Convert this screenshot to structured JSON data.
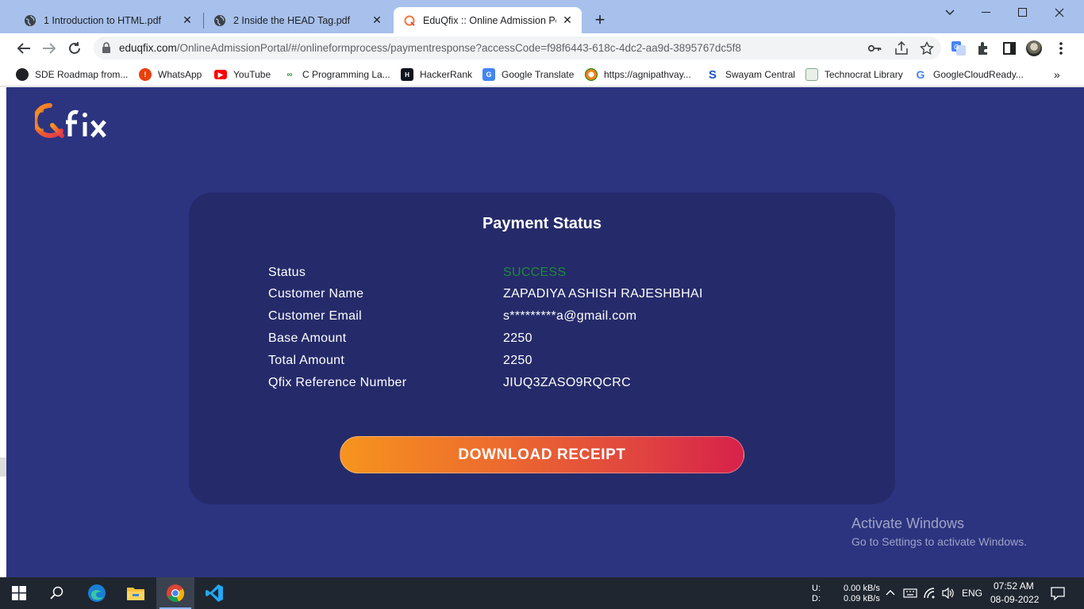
{
  "browser": {
    "tabs": [
      {
        "title": "1 Introduction to HTML.pdf",
        "active": false
      },
      {
        "title": "2 Inside the HEAD Tag.pdf",
        "active": false
      },
      {
        "title": "EduQfix :: Online Admission Portal",
        "active": true
      }
    ],
    "url_host": "eduqfix.com",
    "url_path": "/OnlineAdmissionPortal/#/onlineformprocess/paymentresponse?accessCode=f98f6443-618c-4dc2-aa9d-3895767dc5f8",
    "bookmarks": [
      {
        "label": "SDE Roadmap from...",
        "icon": "bookmark-sde-icon"
      },
      {
        "label": "WhatsApp",
        "icon": "bookmark-whatsapp-icon"
      },
      {
        "label": "YouTube",
        "icon": "bookmark-youtube-icon"
      },
      {
        "label": "C Programming La...",
        "icon": "bookmark-c-programming-icon"
      },
      {
        "label": "HackerRank",
        "icon": "bookmark-hackerrank-icon"
      },
      {
        "label": "Google Translate",
        "icon": "bookmark-google-translate-icon"
      },
      {
        "label": "https://agnipathvay...",
        "icon": "bookmark-agnipath-icon"
      },
      {
        "label": "Swayam Central",
        "icon": "bookmark-swayam-icon"
      },
      {
        "label": "Technocrat Library",
        "icon": "bookmark-technocrat-icon"
      },
      {
        "label": "GoogleCloudReady...",
        "icon": "bookmark-google-icon"
      }
    ]
  },
  "page": {
    "logo_text": "Qfix",
    "card_title": "Payment Status",
    "fields": [
      {
        "label": "Status",
        "value": "SUCCESS"
      },
      {
        "label": "Customer Name",
        "value": "ZAPADIYA ASHISH RAJESHBHAI"
      },
      {
        "label": "Customer Email",
        "value": "s*********a@gmail.com"
      },
      {
        "label": "Base Amount",
        "value": "2250"
      },
      {
        "label": "Total Amount",
        "value": "2250"
      },
      {
        "label": "Qfix Reference Number",
        "value": "JIUQ3ZASO9RQCRC"
      }
    ],
    "download_button": "DOWNLOAD RECEIPT"
  },
  "watermark": {
    "line1": "Activate Windows",
    "line2": "Go to Settings to activate Windows."
  },
  "taskbar": {
    "net_up_label": "U:",
    "net_down_label": "D:",
    "net_up": "0.00 kB/s",
    "net_down": "0.09 kB/s",
    "language": "ENG",
    "time": "07:52 AM",
    "date": "08-09-2022"
  },
  "colors": {
    "page_bg": "#2c3480",
    "card_bg": "#252b6a",
    "success": "#1f8a3a",
    "button_start": "#f7941d",
    "button_end": "#d7214a"
  }
}
